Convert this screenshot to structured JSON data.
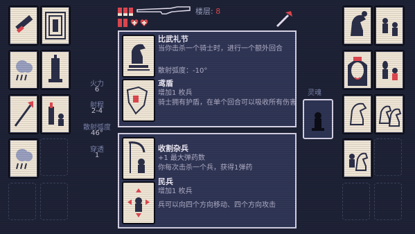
{
  "hud": {
    "floor_label": "楼层:",
    "floor_value": "8",
    "ammo_count": 3,
    "hp_count": 3
  },
  "stats": [
    {
      "label": "火力",
      "value": "6"
    },
    {
      "label": "射程",
      "value": "2-4"
    },
    {
      "label": "散射弧度",
      "value": "46°"
    },
    {
      "label": "穿透",
      "value": "1"
    }
  ],
  "panel_top": {
    "items": [
      {
        "title": "比武礼节",
        "lines": [
          "当你击杀一个骑士时，进行一个额外回合",
          "散射弧度：-10°"
        ],
        "icon": "knight-tournament-icon"
      },
      {
        "title": "鸢盾",
        "lines": [
          "增加1 枚兵",
          "骑士拥有护盾，在单个回合可以吸收所有伤害"
        ],
        "icon": "kite-shield-icon"
      }
    ]
  },
  "panel_bottom": {
    "items": [
      {
        "title": "收割杂兵",
        "lines": [
          "+1 最大弹药数",
          "你每次击杀一个兵，获得1弹药"
        ],
        "icon": "scythe-pawn-icon"
      },
      {
        "title": "民兵",
        "lines": [
          "增加1 枚兵",
          "兵可以向四个方向移动、四个方向攻击"
        ],
        "icon": "militia-pawn-icon"
      }
    ]
  },
  "soul": {
    "label": "灵魂",
    "icon": "pawn-soul-icon"
  },
  "colors": {
    "accent_red": "#e04850",
    "card_bg": "#f0e6d6",
    "bg": "#1e2236",
    "panel": "#303656"
  }
}
